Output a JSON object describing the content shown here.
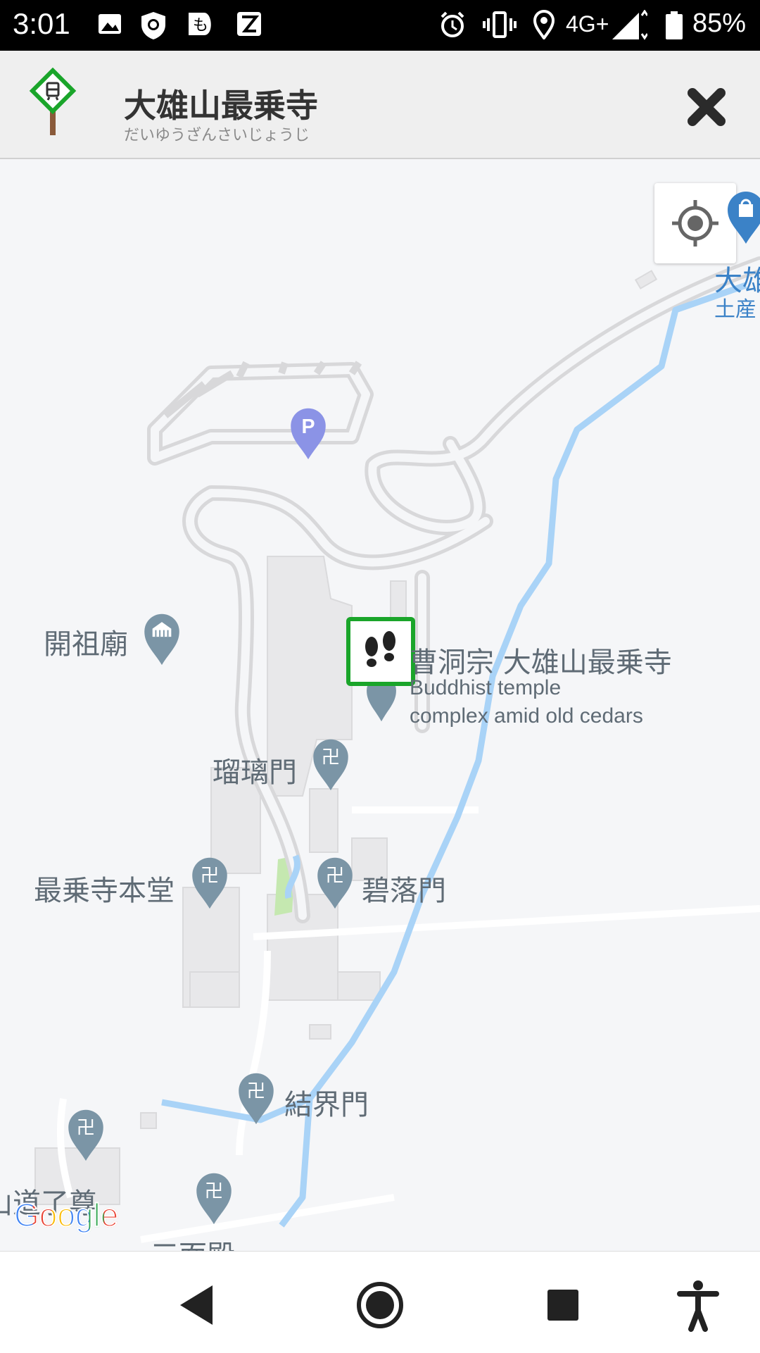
{
  "status_bar": {
    "time": "3:01",
    "network": "4G+",
    "battery": "85%"
  },
  "header": {
    "title": "大雄山最乗寺",
    "subtitle": "だいゆうざんさいじょうじ",
    "icons": {
      "app": "sign-icon",
      "close": "close-icon"
    }
  },
  "map": {
    "places": {
      "kaisobyo": "開祖廟",
      "rurimon": "瑠璃門",
      "hondo": "最乗寺本堂",
      "hekirakumon": "碧落門",
      "kekkaimon": "結界門",
      "ryoson": "山道了尊",
      "sanmonden": "三面殿",
      "shop_line1": "大雄",
      "shop_line2": "土産"
    },
    "selected": {
      "title": "曹洞宗 大雄山最乗寺",
      "desc_line1": "Buddhist temple",
      "desc_line2": "complex amid old cedars"
    },
    "parking_glyph": "P",
    "temple_glyph": "卍",
    "attribution": "Google"
  },
  "colors": {
    "accent_green": "#1aa52a",
    "pin_gray": "#7b95a6",
    "river": "#a9d3f7",
    "parking": "#8b93e6"
  }
}
